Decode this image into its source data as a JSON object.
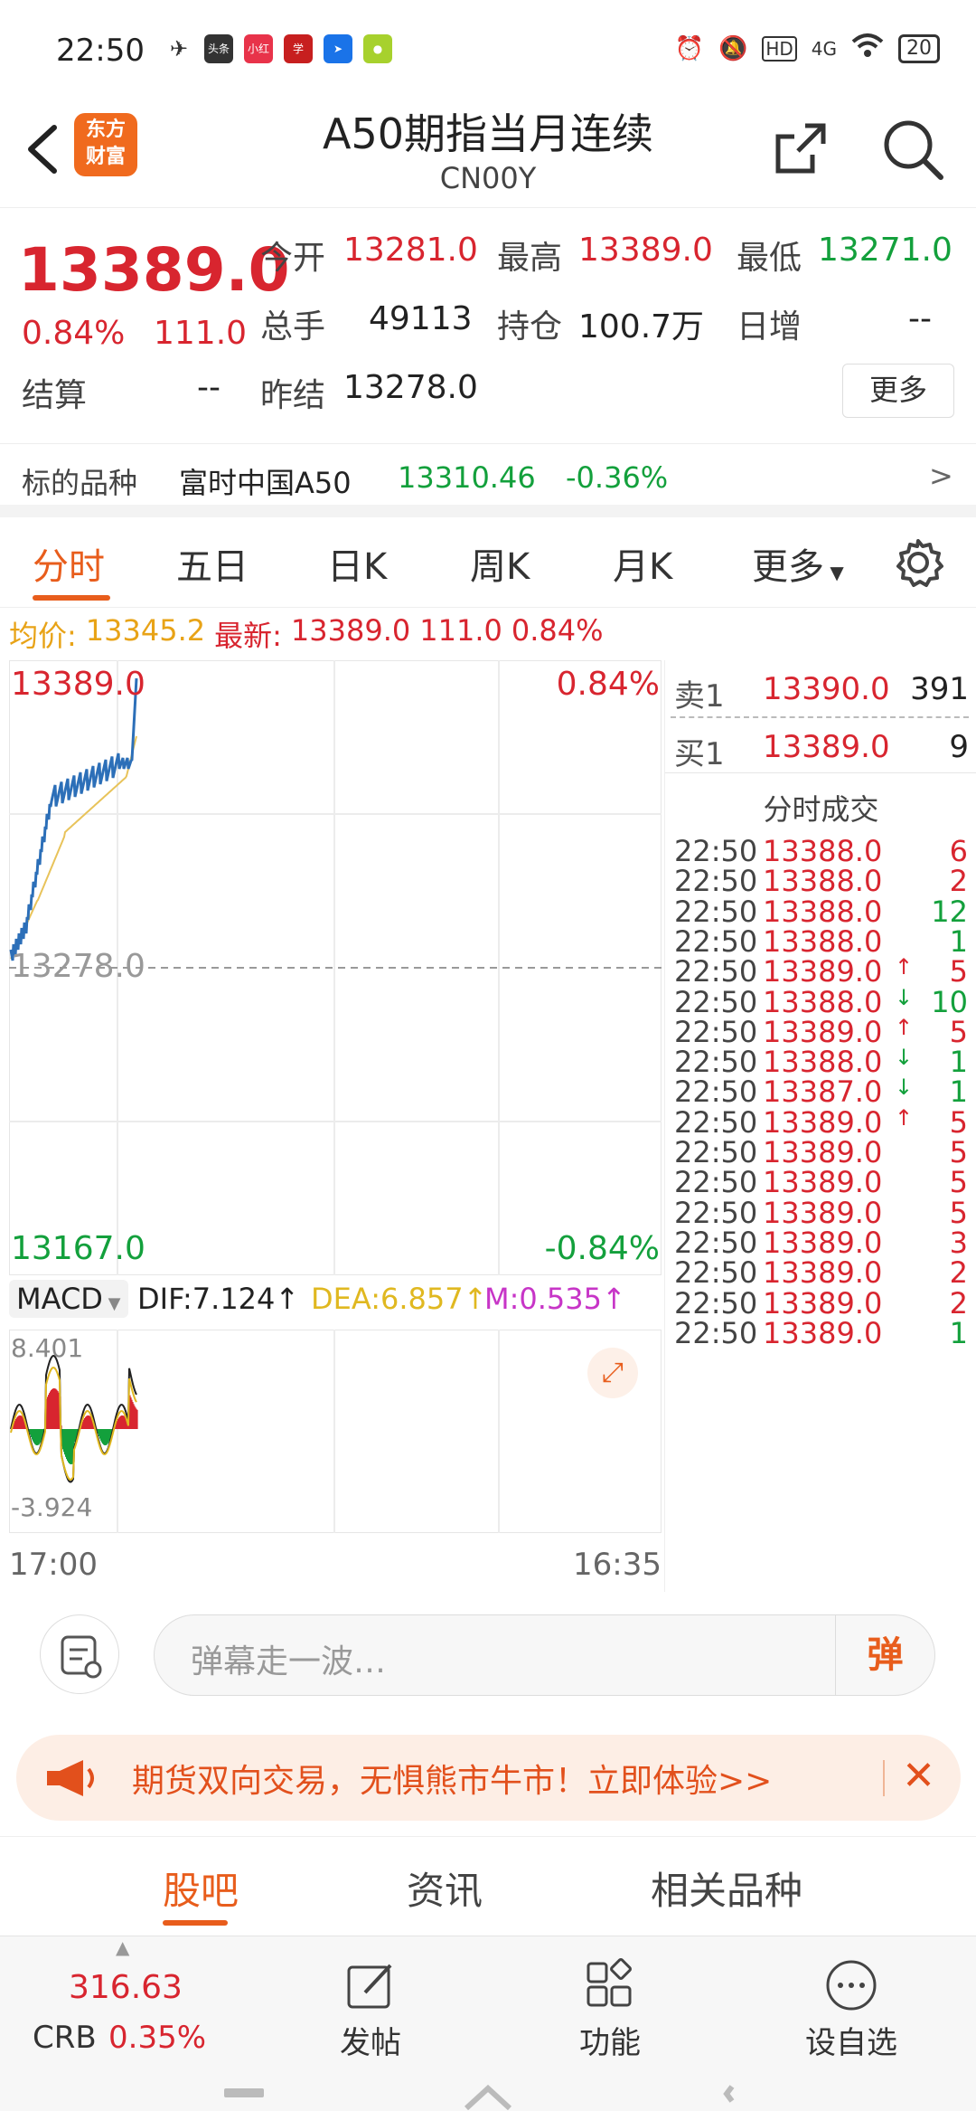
{
  "status_bar": {
    "time": "22:50",
    "app_icons": [
      "telegram-icon",
      "toutiao-icon",
      "xiaohongshu-icon",
      "app-icon",
      "navigation-icon",
      "app-green-icon"
    ],
    "signal": "4G",
    "battery": "20"
  },
  "header": {
    "logo_text_line1": "东方",
    "logo_text_line2": "财富",
    "title": "A50期指当月连续",
    "code": "CN00Y"
  },
  "quote": {
    "price": "13389.0",
    "change_pct": "0.84%",
    "change": "111.0",
    "open_label": "今开",
    "open": "13281.0",
    "high_label": "最高",
    "high": "13389.0",
    "low_label": "最低",
    "low": "13271.0",
    "volume_label": "总手",
    "volume": "49113",
    "position_label": "持仓",
    "position": "100.7万",
    "daily_inc_label": "日增",
    "daily_inc": "--",
    "settle_label": "结算",
    "settle": "--",
    "prev_settle_label": "昨结",
    "prev_settle": "13278.0",
    "more_label": "更多"
  },
  "underlying": {
    "label": "标的品种",
    "name": "富时中国A50",
    "price": "13310.46",
    "change_pct": "-0.36%",
    "arrow": ">"
  },
  "tabs": [
    "分时",
    "五日",
    "日K",
    "周K",
    "月K",
    "更多"
  ],
  "info_line": {
    "avg_label": "均价:",
    "avg": "13345.2",
    "latest_label": "最新:",
    "latest": "13389.0",
    "change": "111.0",
    "change_pct": "0.84%"
  },
  "chart": {
    "top_price": "13389.0",
    "top_pct": "0.84%",
    "mid_price": "13278.0",
    "bottom_price": "13167.0",
    "bottom_pct": "-0.84%",
    "colors": {
      "price_line": "#2c6fb8",
      "avg_line": "#e8c35a"
    }
  },
  "order_book": [
    {
      "label": "卖1",
      "price": "13390.0",
      "qty": "391"
    },
    {
      "label": "买1",
      "price": "13389.0",
      "qty": "9"
    }
  ],
  "trades_title": "分时成交",
  "trades": [
    {
      "time": "22:50",
      "price": "13388.0",
      "dir": "",
      "qty": "6",
      "color": "red"
    },
    {
      "time": "22:50",
      "price": "13388.0",
      "dir": "",
      "qty": "2",
      "color": "red"
    },
    {
      "time": "22:50",
      "price": "13388.0",
      "dir": "",
      "qty": "12",
      "color": "green"
    },
    {
      "time": "22:50",
      "price": "13388.0",
      "dir": "",
      "qty": "1",
      "color": "green"
    },
    {
      "time": "22:50",
      "price": "13389.0",
      "dir": "↑",
      "qty": "5",
      "color": "red"
    },
    {
      "time": "22:50",
      "price": "13388.0",
      "dir": "↓",
      "qty": "10",
      "color": "green"
    },
    {
      "time": "22:50",
      "price": "13389.0",
      "dir": "↑",
      "qty": "5",
      "color": "red"
    },
    {
      "time": "22:50",
      "price": "13388.0",
      "dir": "↓",
      "qty": "1",
      "color": "green"
    },
    {
      "time": "22:50",
      "price": "13387.0",
      "dir": "↓",
      "qty": "1",
      "color": "green"
    },
    {
      "time": "22:50",
      "price": "13389.0",
      "dir": "↑",
      "qty": "5",
      "color": "red"
    },
    {
      "time": "22:50",
      "price": "13389.0",
      "dir": "",
      "qty": "5",
      "color": "red"
    },
    {
      "time": "22:50",
      "price": "13389.0",
      "dir": "",
      "qty": "5",
      "color": "red"
    },
    {
      "time": "22:50",
      "price": "13389.0",
      "dir": "",
      "qty": "5",
      "color": "red"
    },
    {
      "time": "22:50",
      "price": "13389.0",
      "dir": "",
      "qty": "3",
      "color": "red"
    },
    {
      "time": "22:50",
      "price": "13389.0",
      "dir": "",
      "qty": "2",
      "color": "red"
    },
    {
      "time": "22:50",
      "price": "13389.0",
      "dir": "",
      "qty": "2",
      "color": "red"
    },
    {
      "time": "22:50",
      "price": "13389.0",
      "dir": "",
      "qty": "1",
      "color": "green"
    }
  ],
  "macd": {
    "name": "MACD",
    "dif": "DIF:7.124",
    "dea": "DEA:6.857",
    "m": "M:0.535",
    "top": "8.401",
    "bottom": "-3.924"
  },
  "time_axis": {
    "start": "17:00",
    "end": "16:35"
  },
  "danmu": {
    "placeholder": "弹幕走一波…",
    "button": "弹"
  },
  "promo": {
    "text": "期货双向交易，无惧熊市牛市！立即体验>>"
  },
  "bottom_tabs": [
    "股吧",
    "资讯",
    "相关品种"
  ],
  "bottom_bar": {
    "crb_value": "316.63",
    "crb_label": "CRB",
    "crb_pct": "0.35%",
    "post": "发帖",
    "func": "功能",
    "watch": "设自选"
  }
}
